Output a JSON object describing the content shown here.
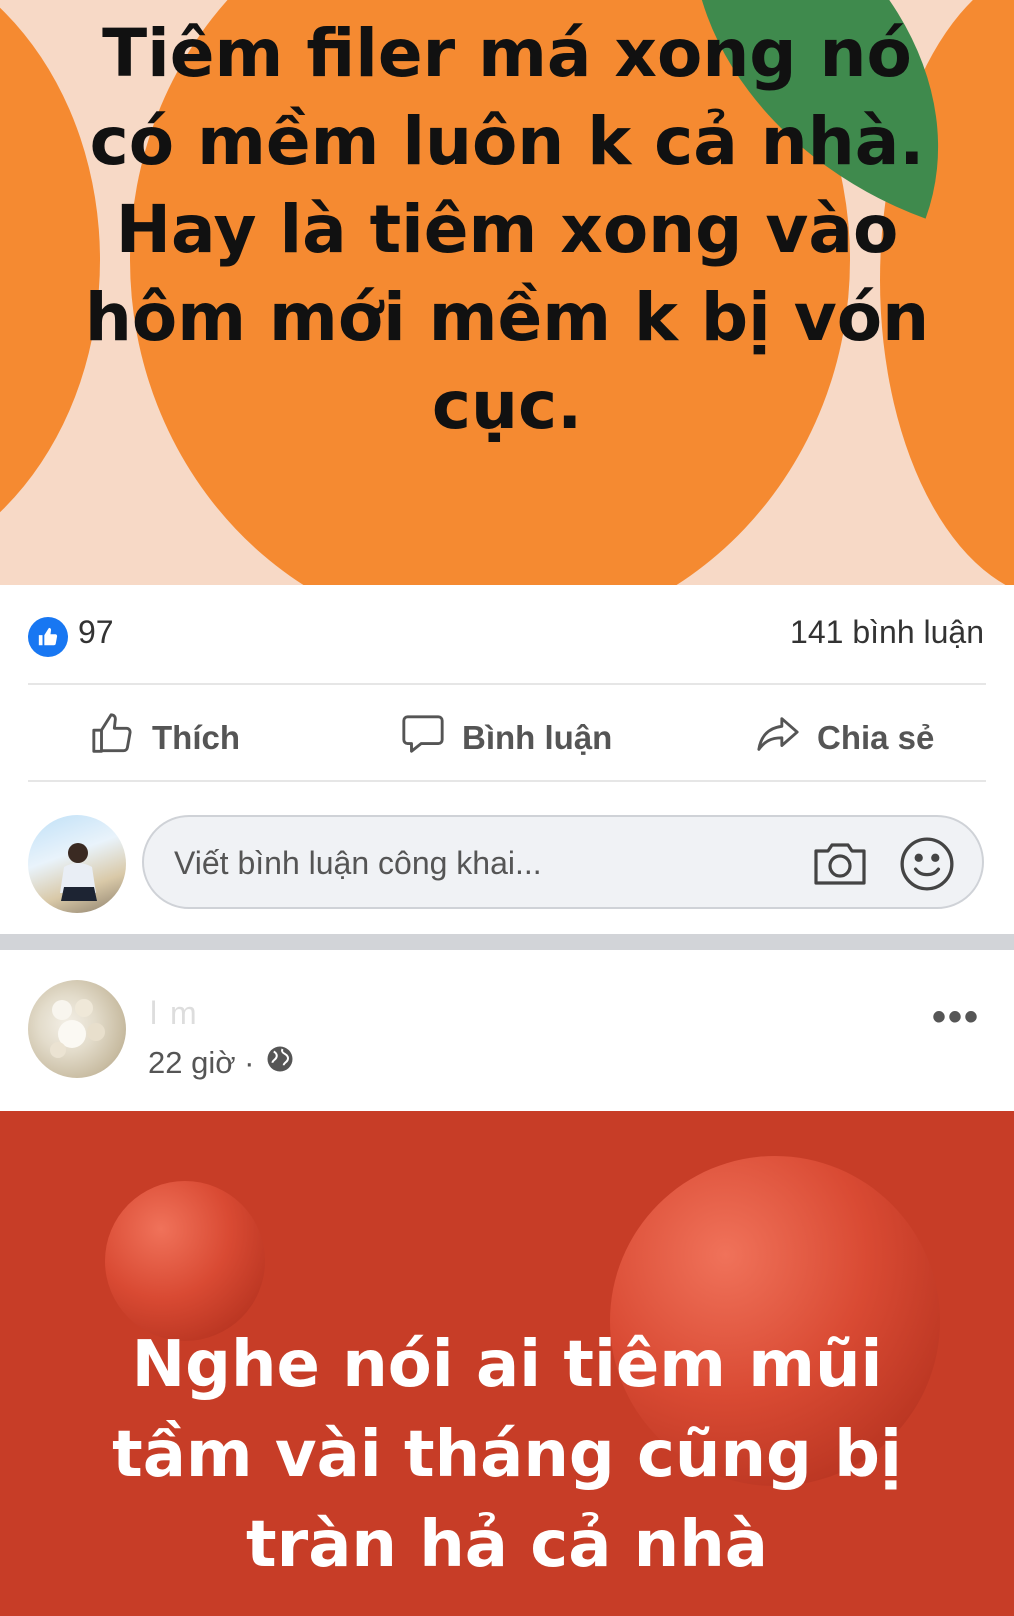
{
  "post1": {
    "text_lines": [
      "Tiêm filer má xong nó",
      "có mềm luôn k cả nhà.",
      "Hay là tiêm xong vào",
      "hôm mới mềm k bị vón",
      "cục."
    ],
    "like_count": "97",
    "comment_count": "141 bình luận",
    "actions": {
      "like": "Thích",
      "comment": "Bình luận",
      "share": "Chia sẻ"
    },
    "comment_placeholder": "Viết bình luận công khai..."
  },
  "post2": {
    "author_name": "l m",
    "time": "22 giờ ·",
    "more_label": "•••",
    "text_lines": [
      "Nghe nói ai tiêm mũi",
      "tầm vài tháng  cũng bị",
      "tràn hả cả nhà"
    ]
  },
  "icons": {
    "like_badge": "thumbs-up-icon",
    "like": "thumbs-up-outline-icon",
    "comment": "speech-bubble-icon",
    "share": "share-arrow-icon",
    "camera": "camera-icon",
    "emoji": "smiley-icon",
    "privacy": "globe-icon",
    "more": "more-dots-icon"
  },
  "colors": {
    "post1_background": "#f7d9c6",
    "orange": "#f58a31",
    "leaf": "#3f8a4d",
    "post2_background": "#c73d27",
    "like_blue": "#1877f2"
  }
}
